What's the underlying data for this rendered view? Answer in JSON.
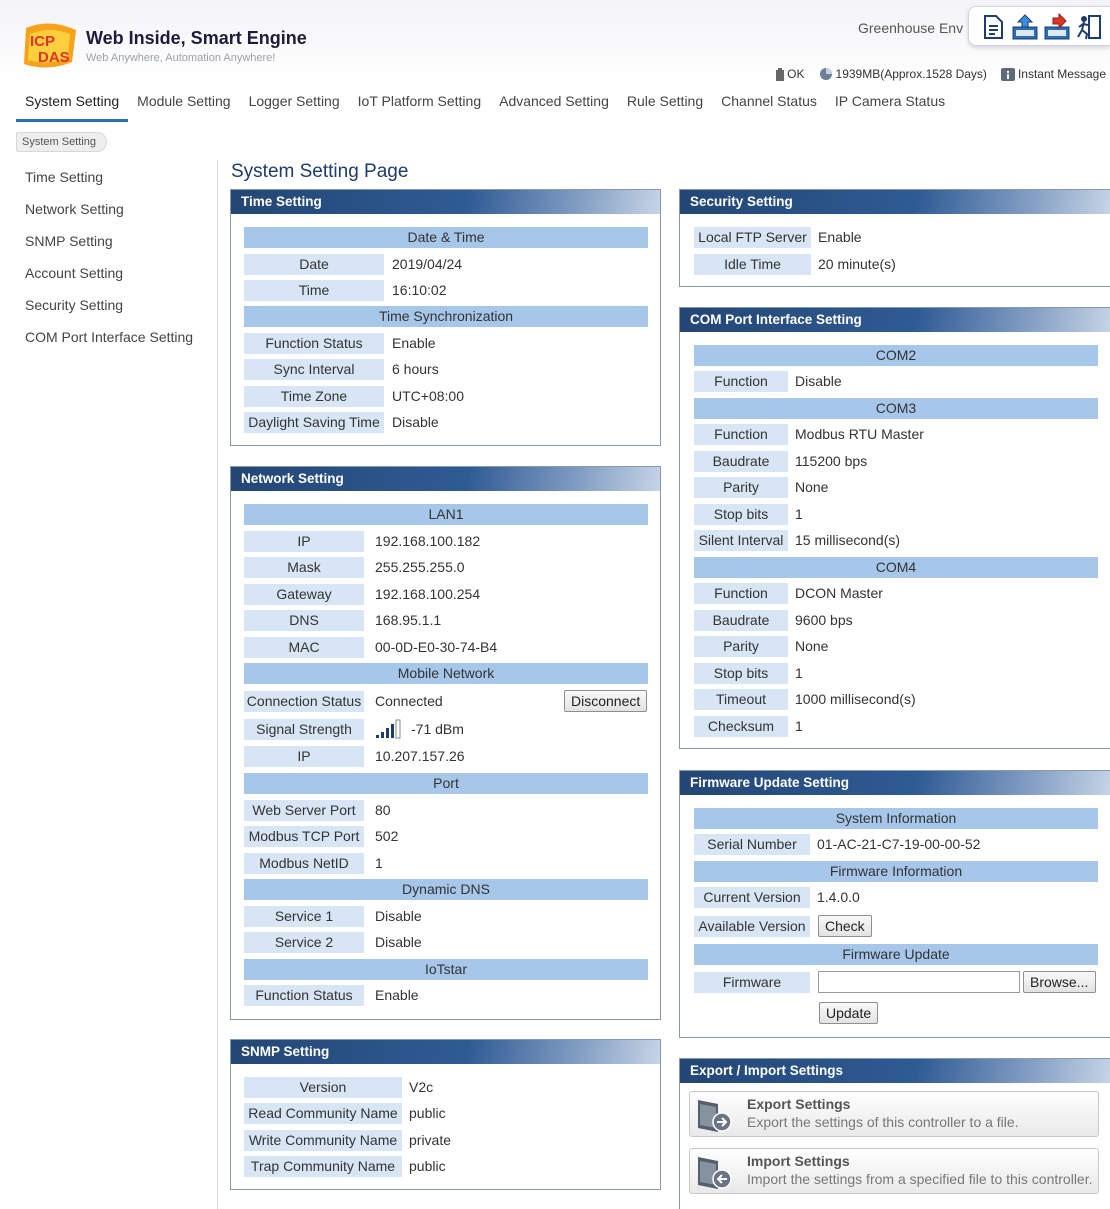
{
  "header": {
    "brand_title": "Web Inside, Smart Engine",
    "brand_subtitle": "Web Anywhere, Automation Anywhere!",
    "logo_text": "ICP DAS",
    "project_name": "Greenhouse Env",
    "status": {
      "battery": "OK",
      "storage": "1939MB(Approx.1528 Days)",
      "instant_message": "Instant Message"
    },
    "tool_icons": [
      "document-icon",
      "upload-icon",
      "download-icon",
      "logout-icon"
    ]
  },
  "nav": {
    "tabs": [
      {
        "label": "System Setting",
        "active": true
      },
      {
        "label": "Module Setting"
      },
      {
        "label": "Logger Setting"
      },
      {
        "label": "IoT Platform Setting"
      },
      {
        "label": "Advanced Setting"
      },
      {
        "label": "Rule Setting"
      },
      {
        "label": "Channel Status"
      },
      {
        "label": "IP Camera Status"
      }
    ]
  },
  "breadcrumb": "System Setting",
  "side_menu": [
    "Time Setting",
    "Network Setting",
    "SNMP Setting",
    "Account Setting",
    "Security Setting",
    "COM Port Interface Setting"
  ],
  "page_title": "System Setting Page",
  "time_setting": {
    "title": "Time Setting",
    "date_time_section": "Date & Time",
    "date_label": "Date",
    "date_value": "2019/04/24",
    "time_label": "Time",
    "time_value": "16:10:02",
    "sync_section": "Time Synchronization",
    "function_status_label": "Function Status",
    "function_status_value": "Enable",
    "sync_interval_label": "Sync Interval",
    "sync_interval_value": "6 hours",
    "time_zone_label": "Time Zone",
    "time_zone_value": "UTC+08:00",
    "dst_label": "Daylight Saving Time",
    "dst_value": "Disable"
  },
  "network_setting": {
    "title": "Network Setting",
    "lan_section": "LAN1",
    "ip_label": "IP",
    "ip_value": "192.168.100.182",
    "mask_label": "Mask",
    "mask_value": "255.255.255.0",
    "gateway_label": "Gateway",
    "gateway_value": "192.168.100.254",
    "dns_label": "DNS",
    "dns_value": "168.95.1.1",
    "mac_label": "MAC",
    "mac_value": "00-0D-E0-30-74-B4",
    "mobile_section": "Mobile Network",
    "connection_label": "Connection Status",
    "connection_value": "Connected",
    "disconnect_button": "Disconnect",
    "signal_label": "Signal Strength",
    "signal_value": "-71 dBm",
    "signal_bars": 4,
    "mobile_ip_label": "IP",
    "mobile_ip_value": "10.207.157.26",
    "port_section": "Port",
    "web_port_label": "Web Server Port",
    "web_port_value": "80",
    "modbus_port_label": "Modbus TCP Port",
    "modbus_port_value": "502",
    "netid_label": "Modbus NetID",
    "netid_value": "1",
    "ddns_section": "Dynamic DNS",
    "service1_label": "Service 1",
    "service1_value": "Disable",
    "service2_label": "Service 2",
    "service2_value": "Disable",
    "iotstar_section": "IoTstar",
    "iotstar_status_label": "Function Status",
    "iotstar_status_value": "Enable"
  },
  "snmp_setting": {
    "title": "SNMP Setting",
    "version_label": "Version",
    "version_value": "V2c",
    "read_label": "Read Community Name",
    "read_value": "public",
    "write_label": "Write Community Name",
    "write_value": "private",
    "trap_label": "Trap Community Name",
    "trap_value": "public"
  },
  "security_setting": {
    "title": "Security Setting",
    "ftp_label": "Local FTP Server",
    "ftp_value": "Enable",
    "idle_label": "Idle Time",
    "idle_value": "20 minute(s)"
  },
  "com_port_setting": {
    "title": "COM Port Interface Setting",
    "com2": {
      "name": "COM2",
      "function_label": "Function",
      "function_value": "Disable"
    },
    "com3": {
      "name": "COM3",
      "function_label": "Function",
      "function_value": "Modbus RTU Master",
      "baudrate_label": "Baudrate",
      "baudrate_value": "115200 bps",
      "parity_label": "Parity",
      "parity_value": "None",
      "stopbits_label": "Stop bits",
      "stopbits_value": "1",
      "silent_label": "Silent Interval",
      "silent_value": "15 millisecond(s)"
    },
    "com4": {
      "name": "COM4",
      "function_label": "Function",
      "function_value": "DCON Master",
      "baudrate_label": "Baudrate",
      "baudrate_value": "9600 bps",
      "parity_label": "Parity",
      "parity_value": "None",
      "stopbits_label": "Stop bits",
      "stopbits_value": "1",
      "timeout_label": "Timeout",
      "timeout_value": "1000 millisecond(s)",
      "checksum_label": "Checksum",
      "checksum_value": "1"
    }
  },
  "firmware_setting": {
    "title": "Firmware Update Setting",
    "system_info_section": "System Information",
    "serial_label": "Serial Number",
    "serial_value": "01-AC-21-C7-19-00-00-52",
    "firmware_info_section": "Firmware Information",
    "current_label": "Current Version",
    "current_value": "1.4.0.0",
    "available_label": "Available Version",
    "check_button": "Check",
    "update_section": "Firmware Update",
    "firmware_label": "Firmware",
    "firmware_value": "",
    "browse_button": "Browse...",
    "update_button": "Update"
  },
  "export_import": {
    "title": "Export / Import Settings",
    "export_title": "Export Settings",
    "export_desc": "Export the settings of this controller to a file.",
    "import_title": "Import Settings",
    "import_desc": "Import the settings from a specified file to this controller."
  },
  "colors": {
    "panel_header": "#2a5184",
    "label_bg": "#d7e5f4",
    "section_bg": "#a6c7ea",
    "nav_active": "#2c6eb5"
  }
}
